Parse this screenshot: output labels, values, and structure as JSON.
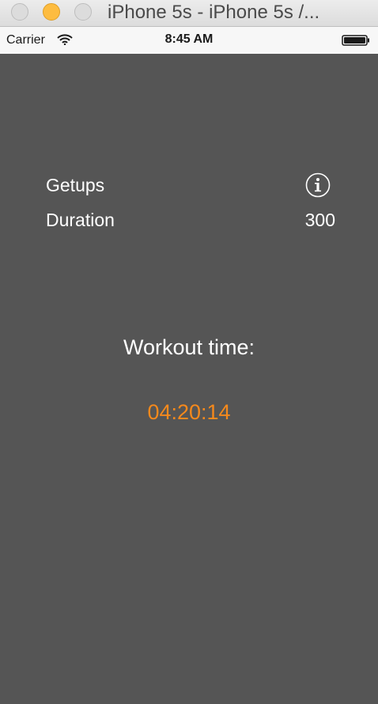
{
  "window": {
    "title": "iPhone 5s - iPhone 5s /..."
  },
  "statusbar": {
    "carrier": "Carrier",
    "time": "8:45 AM",
    "icons": [
      "wifi-icon",
      "battery-icon"
    ]
  },
  "settings": {
    "getups_label": "Getups",
    "getups_icon": "info-icon",
    "duration_label": "Duration",
    "duration_value": "300"
  },
  "workout": {
    "label": "Workout time:",
    "time": "04:20:14"
  },
  "colors": {
    "background": "#555555",
    "accent": "#f5891c",
    "text": "#ffffff",
    "minimize_button": "#fdbc40"
  }
}
